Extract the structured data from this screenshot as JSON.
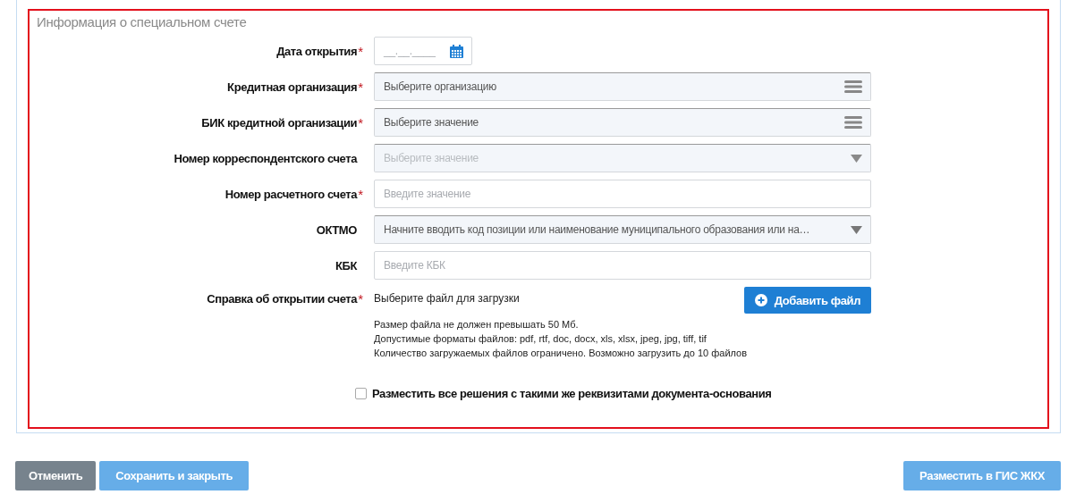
{
  "section": {
    "title": "Информация о специальном счете",
    "fields": [
      {
        "label": "Дата открытия",
        "required_mark": "*",
        "kind": "date",
        "placeholder": "__.__.____",
        "disabled": false
      },
      {
        "label": "Кредитная организация",
        "required_mark": "*",
        "kind": "list",
        "placeholder": "Выберите организацию",
        "disabled": false
      },
      {
        "label": "БИК кредитной организации",
        "required_mark": "*",
        "kind": "list",
        "placeholder": "Выберите значение",
        "disabled": false
      },
      {
        "label": "Номер корреспондентского счета",
        "kind": "select",
        "placeholder": "Выберите значение",
        "disabled": true
      },
      {
        "label": "Номер расчетного счета",
        "required_mark": "*",
        "kind": "text",
        "placeholder": "Введите значение",
        "disabled": false
      },
      {
        "label": "ОКТМО",
        "kind": "select",
        "placeholder": "Начните вводить код позиции или наименование муниципального образования или на…",
        "disabled": false
      },
      {
        "label": "КБК",
        "kind": "text",
        "placeholder": "Введите КБК",
        "disabled": false
      }
    ],
    "upload": {
      "label": "Справка об открытии счета",
      "required_mark": "*",
      "prompt": "Выберите файл для загрузки",
      "button": "Добавить файл",
      "hints": [
        "Размер файла не должен превышать 50 Мб.",
        "Допустимые форматы файлов: pdf, rtf, doc, docx, xls, xlsx, jpeg, jpg, tiff, tif",
        "Количество загружаемых файлов ограничено. Возможно загрузить до 10 файлов"
      ]
    },
    "checkbox": {
      "label": "Разместить все решения с такими же реквизитами документа-основания",
      "checked": false
    }
  },
  "actions": {
    "left": [
      {
        "label": "Отменить",
        "kind": "secondary"
      },
      {
        "label": "Сохранить и закрыть",
        "kind": "primary"
      }
    ],
    "right": [
      {
        "label": "Разместить в ГИС ЖКХ",
        "kind": "primary"
      }
    ]
  }
}
